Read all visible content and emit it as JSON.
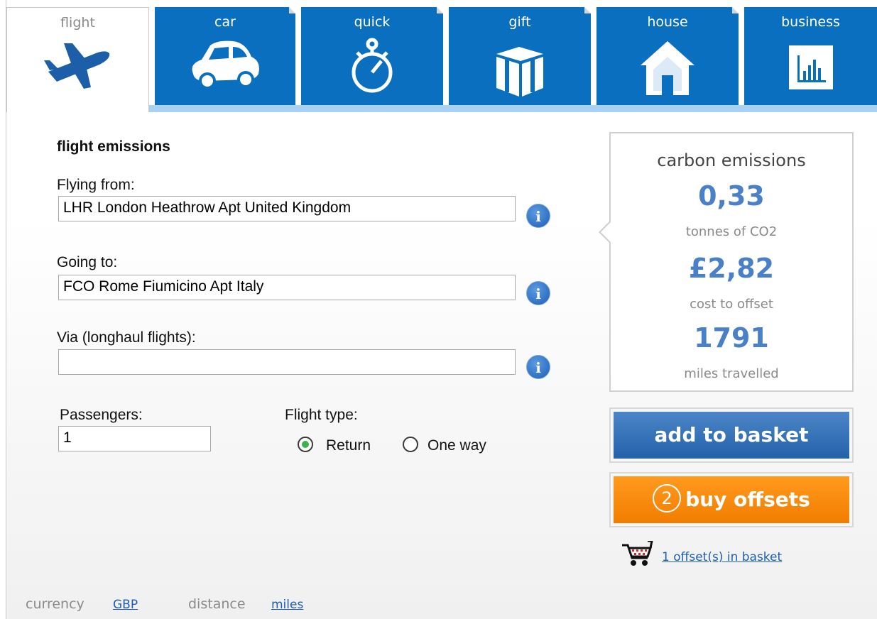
{
  "tabs": [
    {
      "label": "flight",
      "icon": "plane-icon",
      "active": true
    },
    {
      "label": "car",
      "icon": "car-icon"
    },
    {
      "label": "quick",
      "icon": "stopwatch-icon"
    },
    {
      "label": "gift",
      "icon": "gift-icon"
    },
    {
      "label": "house",
      "icon": "house-icon"
    },
    {
      "label": "business",
      "icon": "bar-chart-icon"
    }
  ],
  "form": {
    "title": "flight emissions",
    "from_label": "Flying from:",
    "from_value": "LHR London Heathrow Apt United Kingdom",
    "to_label": "Going to:",
    "to_value": "FCO Rome Fiumicino Apt Italy",
    "via_label": "Via (longhaul flights):",
    "via_value": "",
    "passengers_label": "Passengers:",
    "passengers_value": "1",
    "flight_type_label": "Flight type:",
    "flight_type_options": [
      "Return",
      "One way"
    ],
    "flight_type_selected": "Return",
    "info_glyph": "i"
  },
  "summary": {
    "title": "carbon emissions",
    "co2_value": "0,33",
    "co2_unit": "tonnes of CO2",
    "cost_value": "£2,82",
    "cost_unit": "cost to offset",
    "miles_value": "1791",
    "miles_unit": "miles travelled"
  },
  "actions": {
    "add_label": "add to basket",
    "buy_step": "2",
    "buy_label": "buy offsets",
    "basket_link": "1 offset(s) in basket"
  },
  "footer": {
    "currency_label": "currency",
    "currency_value": "GBP",
    "distance_label": "distance",
    "distance_value": "miles"
  },
  "colors": {
    "tab_blue": "#0b6fc0",
    "tab_strip": "#a9d2f2",
    "value_blue": "#4a80c8",
    "button_blue": "#2361a8",
    "button_orange": "#f27d00",
    "radio_green": "#3cb34a"
  }
}
